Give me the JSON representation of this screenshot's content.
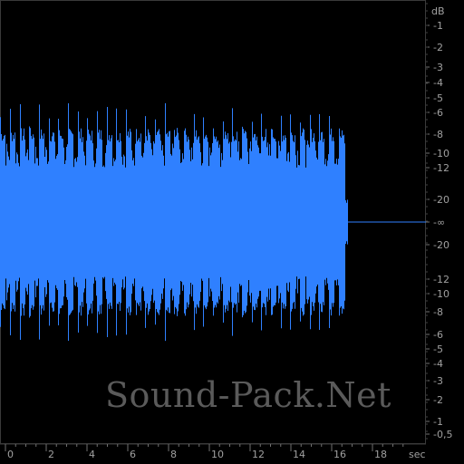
{
  "watermark": "Sound-Pack.Net",
  "colors": {
    "background": "#000000",
    "waveform": "#2f80ff",
    "axis_text": "#a0a0a0",
    "tick": "#707070",
    "border": "#3a3a3a",
    "watermark": "#5a5a5a"
  },
  "db_scale": {
    "unit_label": "dB",
    "upper_ticks": [
      "-1",
      "-2",
      "-3",
      "-4",
      "-5",
      "-6",
      "-8",
      "-10",
      "-12",
      "-20"
    ],
    "center_label": "-∞",
    "lower_ticks": [
      "-∞",
      "-20",
      "-12",
      "-10",
      "-8",
      "-6",
      "-5",
      "-4",
      "-3",
      "-2",
      "-1",
      "-0,5"
    ]
  },
  "time_scale": {
    "unit_label": "sec",
    "ticks": [
      "0",
      "2",
      "4",
      "6",
      "8",
      "10",
      "12",
      "14",
      "16",
      "18"
    ]
  },
  "waveform": {
    "duration_sec": 16.8,
    "view_end_sec": 19.5,
    "bursts": 36
  }
}
